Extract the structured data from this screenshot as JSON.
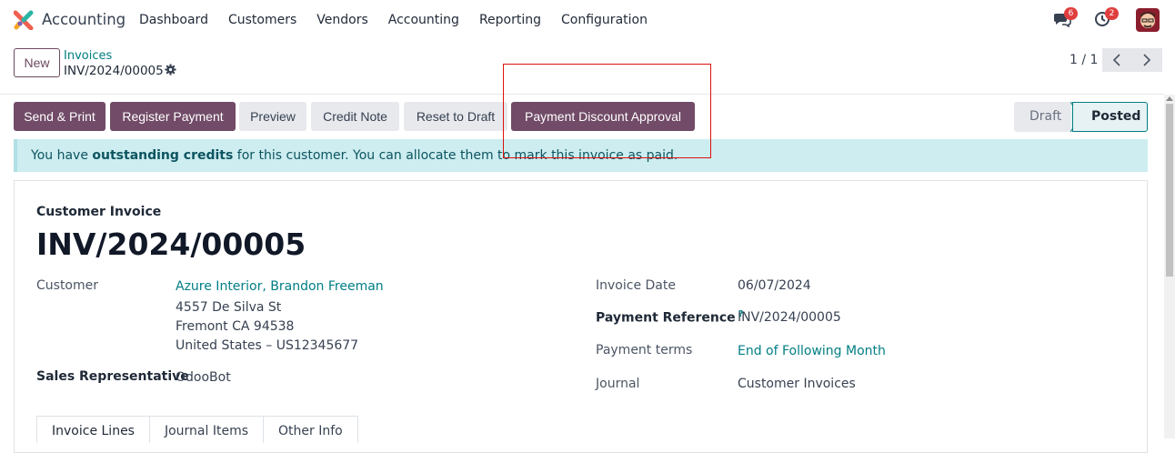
{
  "navbar": {
    "app_name": "Accounting",
    "menu": [
      "Dashboard",
      "Customers",
      "Vendors",
      "Accounting",
      "Reporting",
      "Configuration"
    ],
    "messages_count": "6",
    "activities_count": "2"
  },
  "control_panel": {
    "new_label": "New",
    "breadcrumb_parent": "Invoices",
    "breadcrumb_current": "INV/2024/00005",
    "pager": "1 / 1"
  },
  "actions": {
    "send_print": "Send & Print",
    "register_payment": "Register Payment",
    "preview": "Preview",
    "credit_note": "Credit Note",
    "reset_draft": "Reset to Draft",
    "payment_discount": "Payment Discount Approval"
  },
  "status": {
    "draft": "Draft",
    "posted": "Posted"
  },
  "alert": {
    "prefix": "You have ",
    "bold": "outstanding credits",
    "suffix": " for this customer. You can allocate them to mark this invoice as paid."
  },
  "invoice": {
    "type": "Customer Invoice",
    "name": "INV/2024/00005",
    "customer_label": "Customer",
    "customer_name": "Azure Interior, Brandon Freeman",
    "address_1": "4557 De Silva St",
    "address_2": "Fremont CA 94538",
    "address_3": "United States – US12345677",
    "salesrep_label": "Sales Representative",
    "salesrep_value": "OdooBot",
    "date_label": "Invoice Date",
    "date_value": "06/07/2024",
    "payref_label": "Payment Reference",
    "payref_help": "?",
    "payref_value": "INV/2024/00005",
    "terms_label": "Payment terms",
    "terms_value": "End of Following Month",
    "journal_label": "Journal",
    "journal_value": "Customer Invoices"
  },
  "tabs": [
    "Invoice Lines",
    "Journal Items",
    "Other Info"
  ],
  "colors": {
    "primary": "#714b67",
    "link": "#017e84",
    "alert_bg": "#cdedf0",
    "highlight": "#dd1111"
  }
}
